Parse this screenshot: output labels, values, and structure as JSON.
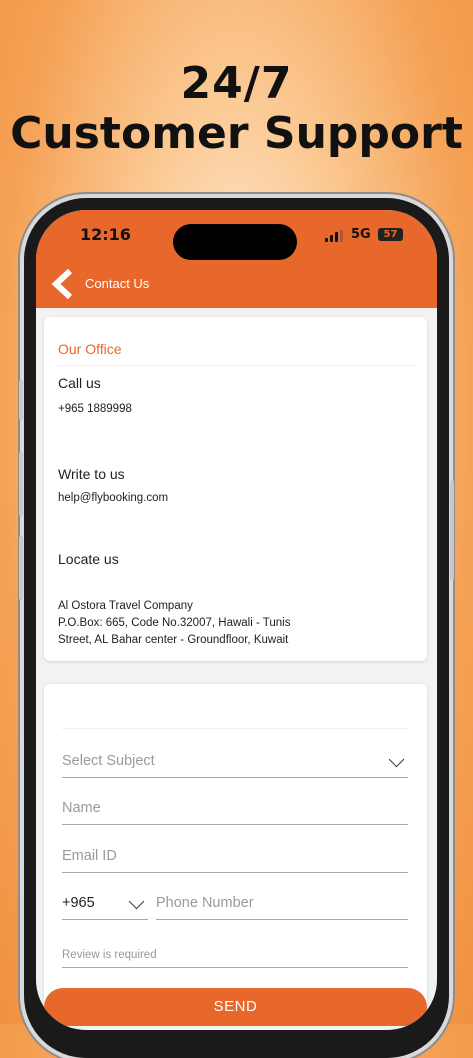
{
  "promo": {
    "line1": "24/7",
    "line2": "Customer Support"
  },
  "status_bar": {
    "time": "12:16",
    "network": "5G",
    "battery": "57"
  },
  "header": {
    "title": "Contact Us"
  },
  "office": {
    "title": "Our Office",
    "call_label": "Call us",
    "phone": "+965 1889998",
    "write_label": "Write to us",
    "email": "help@flybooking.com",
    "locate_label": "Locate us",
    "address_line1": "Al Ostora Travel Company",
    "address_line2": "P.O.Box: 665, Code No.32007, Hawali - Tunis",
    "address_line3": "Street, AL Bahar center - Groundfloor, Kuwait"
  },
  "form": {
    "subject_placeholder": "Select Subject",
    "name_placeholder": "Name",
    "email_placeholder": "Email ID",
    "country_code": "+965",
    "phone_placeholder": "Phone Number",
    "review_placeholder": "Review is required",
    "send_label": "SEND"
  },
  "colors": {
    "accent": "#e8672a"
  }
}
